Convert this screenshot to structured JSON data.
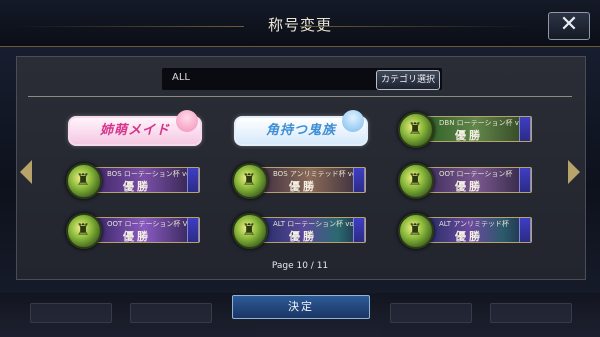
{
  "dialog": {
    "title": "称号変更",
    "close_symbol": "✕"
  },
  "filter": {
    "value": "ALL",
    "category_button": "カテゴリ選択"
  },
  "titles": [
    {
      "type": "banner",
      "text": "姉萌メイド",
      "theme": "pink"
    },
    {
      "type": "banner",
      "text": "角持つ鬼族",
      "theme": "blue"
    },
    {
      "type": "plate",
      "sub": "DBN ローテーション杯 vol.2",
      "main": "優勝",
      "theme": "green"
    },
    {
      "type": "plate",
      "sub": "BOS ローテーション杯 vol.3",
      "main": "優勝",
      "theme": "purple"
    },
    {
      "type": "plate",
      "sub": "BOS アンリミテッド杯 vol.2",
      "main": "優勝",
      "theme": "purple"
    },
    {
      "type": "plate",
      "sub": "OOT ローテーション杯",
      "main": "優勝",
      "theme": "purple"
    },
    {
      "type": "plate",
      "sub": "OOT ローテーション杯 Vol.3",
      "main": "優勝",
      "theme": "purple"
    },
    {
      "type": "plate",
      "sub": "ALT ローテーション杯 vol.2",
      "main": "優勝",
      "theme": "teal"
    },
    {
      "type": "plate",
      "sub": "ALT アンリミテッド杯",
      "main": "優勝",
      "theme": "teal"
    }
  ],
  "pagination": {
    "text": "Page 10 / 11"
  },
  "footer": {
    "confirm_label": "決定"
  },
  "colors": {
    "gold_trim": "#b6a36c",
    "confirm_blue": "#2d5b96"
  }
}
